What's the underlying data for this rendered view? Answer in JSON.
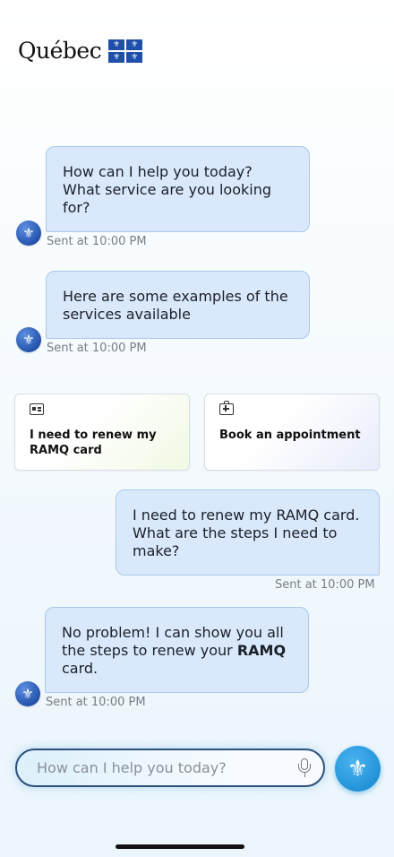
{
  "header": {
    "logo_text": "Québec",
    "flag_symbol": "⚜"
  },
  "messages": [
    {
      "role": "bot",
      "text": "How can I help you today? What service are you looking for?",
      "time": "Sent at 10:00 PM"
    },
    {
      "role": "bot",
      "text": "Here are some examples of the services available",
      "time": "Sent at 10:00 PM"
    },
    {
      "role": "user",
      "text": "I need to renew my RAMQ card. What are the steps I need to make?",
      "time": "Sent at 10:00 PM"
    },
    {
      "role": "bot",
      "text_before": "No problem! I can show you all the steps to renew your ",
      "text_bold": "RAMQ",
      "text_after": " card.",
      "time": "Sent at 10:00 PM"
    }
  ],
  "suggestions": [
    {
      "label": "I need to renew my RAMQ card",
      "icon": "id-card-icon"
    },
    {
      "label": "Book an appointment",
      "icon": "medical-kit-icon"
    }
  ],
  "composer": {
    "placeholder": "How can I help you today?",
    "mic_icon": "microphone-icon",
    "send_icon_symbol": "⚜"
  },
  "colors": {
    "bubble_bg": "#d9e9fb",
    "bubble_border": "#a9c8ec",
    "accent": "#1d8fd6",
    "brand_blue": "#1f4fa8"
  }
}
